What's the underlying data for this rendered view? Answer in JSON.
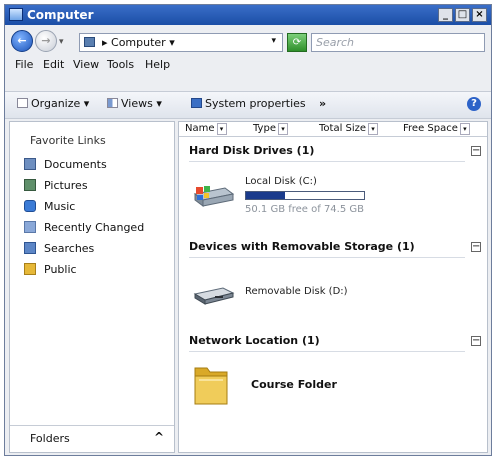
{
  "window": {
    "title": "Computer"
  },
  "title_buttons": {
    "minimize": "_",
    "maximize": "□",
    "close": "×"
  },
  "nav": {
    "address_text": "▸ Computer ▾",
    "search_placeholder": "Search"
  },
  "menu": [
    {
      "label": "File"
    },
    {
      "label": "Edit"
    },
    {
      "label": "View"
    },
    {
      "label": "Tools"
    },
    {
      "label": "Help"
    }
  ],
  "toolbar": {
    "organize": "Organize ▾",
    "views": "Views ▾",
    "system_properties": "System properties",
    "more": "»",
    "help": "?"
  },
  "favorites": {
    "title": "Favorite Links",
    "items": [
      {
        "label": "Documents",
        "icon": "documents-icon",
        "color": "#6e8fc0"
      },
      {
        "label": "Pictures",
        "icon": "pictures-icon",
        "color": "#5f8f6a"
      },
      {
        "label": "Music",
        "icon": "music-icon",
        "color": "#3b7bd6"
      },
      {
        "label": "Recently Changed",
        "icon": "recent-icon",
        "color": "#8aa8d8"
      },
      {
        "label": "Searches",
        "icon": "searches-icon",
        "color": "#5d86c6"
      },
      {
        "label": "Public",
        "icon": "public-folder-icon",
        "color": "#e6b838"
      }
    ],
    "folders_label": "Folders",
    "folders_chevron": "^"
  },
  "columns": [
    {
      "label": "Name"
    },
    {
      "label": "Type"
    },
    {
      "label": "Total Size"
    },
    {
      "label": "Free Space"
    }
  ],
  "groups": {
    "hdd": {
      "title": "Hard Disk Drives (1)",
      "drive_label": "Local Disk (C:)",
      "free_text": "50.1 GB free of 74.5 GB",
      "used_fraction": 0.33
    },
    "removable": {
      "title": "Devices with Removable Storage (1)",
      "drive_label": "Removable Disk (D:)"
    },
    "network": {
      "title": "Network Location (1)",
      "folder_label": "Course Folder"
    }
  },
  "colors": {
    "titlebar": "#1b4ea6",
    "progress_fill": "#1a3b8c",
    "folder": "#e8c04a"
  }
}
